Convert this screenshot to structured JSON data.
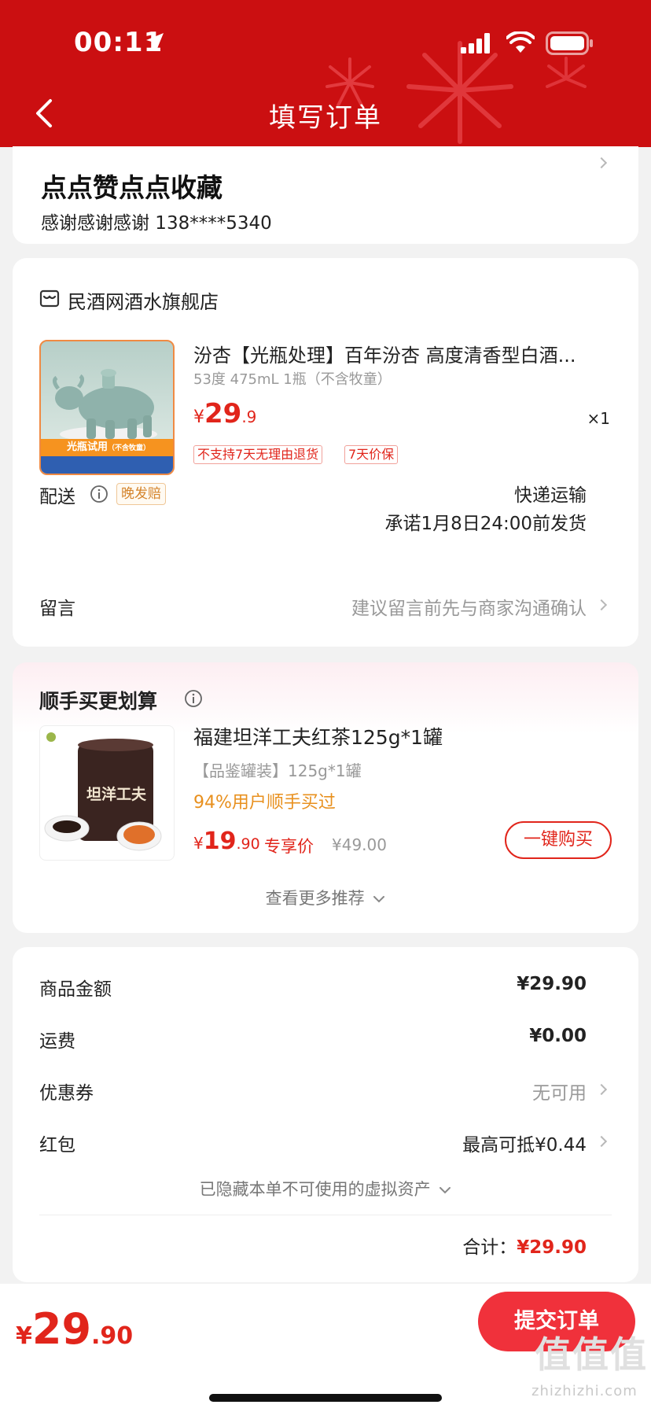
{
  "status_bar": {
    "time": "00:11"
  },
  "header": {
    "title": "填写订单"
  },
  "address": {
    "name": "点点赞点点收藏",
    "contact": "感谢感谢感谢  138****5340"
  },
  "shop": {
    "name": "民酒网酒水旗舰店",
    "product": {
      "title": "汾杏【光瓶处理】百年汾杏  高度清香型白酒...",
      "spec": "53度 475mL 1瓶（不含牧童）",
      "price_yen": "¥",
      "price_int": "29",
      "price_dec": ".9",
      "quantity": "×1",
      "image_banner": "光瓶试用",
      "image_banner_sub": "（不含牧童）",
      "tags": [
        "不支持7天无理由退货",
        "7天价保"
      ]
    },
    "shipping": {
      "label": "配送",
      "badge": "晚发赔",
      "method": "快递运输",
      "promise": "承诺1月8日24:00前发货"
    },
    "message": {
      "label": "留言",
      "placeholder": "建议留言前先与商家沟通确认"
    }
  },
  "recommend": {
    "title": "顺手买更划算",
    "item": {
      "name": "福建坦洋工夫红茶125g*1罐",
      "spec": "【品鉴罐装】125g*1罐",
      "social_proof": "94%用户顺手买过",
      "price_yen": "¥",
      "price_int": "19",
      "price_dec": ".90",
      "exclusive_label": "专享价",
      "original_price": "¥49.00",
      "buy_button": "一键购买",
      "image_text": "坦洋工夫"
    },
    "more_link": "查看更多推荐"
  },
  "price_summary": {
    "rows": [
      {
        "label": "商品金额",
        "value": "¥29.90"
      },
      {
        "label": "运费",
        "value": "¥0.00"
      },
      {
        "label": "优惠券",
        "value": "无可用"
      },
      {
        "label": "红包",
        "value": "最高可抵¥0.44"
      }
    ],
    "hidden_assets": "已隐藏本单不可使用的虚拟资产",
    "total_label": "合计：",
    "total_value": "¥29.90"
  },
  "bottom_bar": {
    "price_yen": "¥",
    "price_int": "29",
    "price_dec": ".90",
    "submit_button": "提交订单"
  },
  "watermark": "zhizhizhi.com",
  "colors": {
    "header_red": "#cb0f11",
    "price_red": "#e1251b",
    "submit_red": "#f0313b",
    "social_orange": "#e8901e"
  }
}
